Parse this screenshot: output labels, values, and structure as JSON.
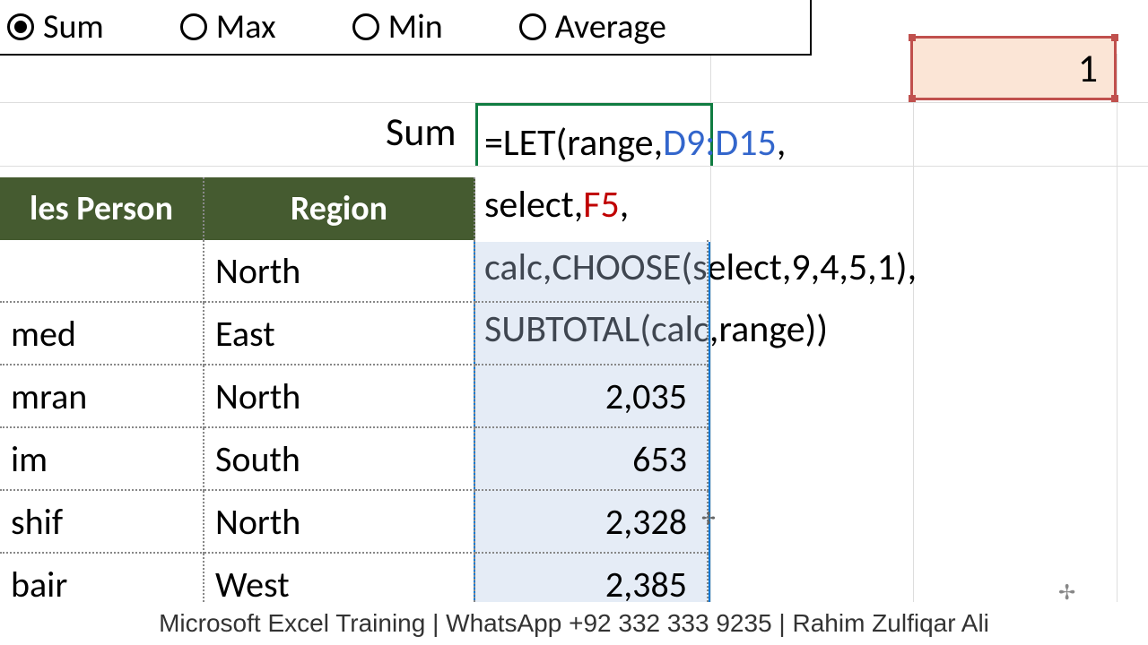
{
  "radios": {
    "sum": "Sum",
    "max": "Max",
    "min": "Min",
    "average": "Average",
    "selected": "sum"
  },
  "linked_value": "1",
  "result_label": "Sum",
  "formula": {
    "line1_a": "=LET(range,",
    "line1_ref": "D9:D15",
    "line1_b": ",",
    "line2_a": "select,",
    "line2_ref": "F5",
    "line2_b": ",",
    "line3": "calc,CHOOSE(select,9,4,5,1),",
    "line4": "SUBTOTAL(calc,range))"
  },
  "headers": {
    "person": "les Person",
    "region": "Region"
  },
  "rows": [
    {
      "person": "",
      "region": "North",
      "value": ""
    },
    {
      "person": "med",
      "region": "East",
      "value": ""
    },
    {
      "person": "mran",
      "region": "North",
      "value": "2,035"
    },
    {
      "person": "im",
      "region": "South",
      "value": "653"
    },
    {
      "person": "shif",
      "region": "North",
      "value": "2,328"
    },
    {
      "person": "bair",
      "region": "West",
      "value": "2,385"
    }
  ],
  "footer": "Microsoft Excel Training | WhatsApp +92 332 333 9235 | Rahim Zulfiqar Ali"
}
